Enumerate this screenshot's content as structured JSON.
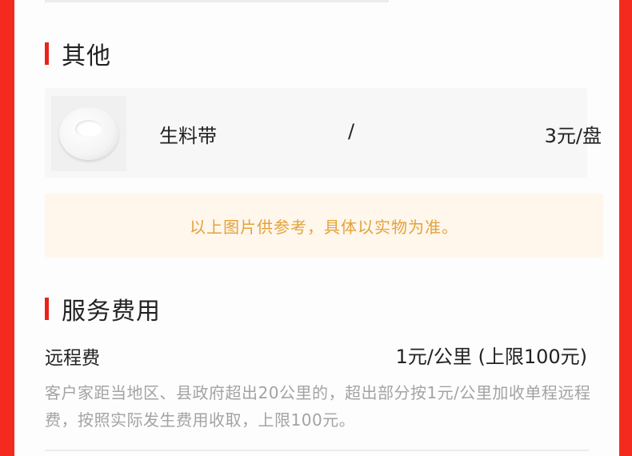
{
  "colors": {
    "side_red": "#f52a1e",
    "accent_bar": "#e8231b",
    "notice_bg": "#fff6ec",
    "notice_text": "#e3a33a",
    "muted_text": "#a3a3a3"
  },
  "other_section": {
    "title": "其他",
    "item": {
      "icon": "ptfe-tape-image",
      "name": "生料带",
      "spec": "/",
      "price": "3元/盘"
    }
  },
  "notice": {
    "text": "以上图片供参考，具体以实物为准。"
  },
  "service_section": {
    "title": "服务费用",
    "fee": {
      "name": "远程费",
      "price": "1元/公里 (上限100元)",
      "description": "客户家距当地区、县政府超出20公里的，超出部分按1元/公里加收单程远程费，按照实际发生费用收取，上限100元。"
    }
  }
}
